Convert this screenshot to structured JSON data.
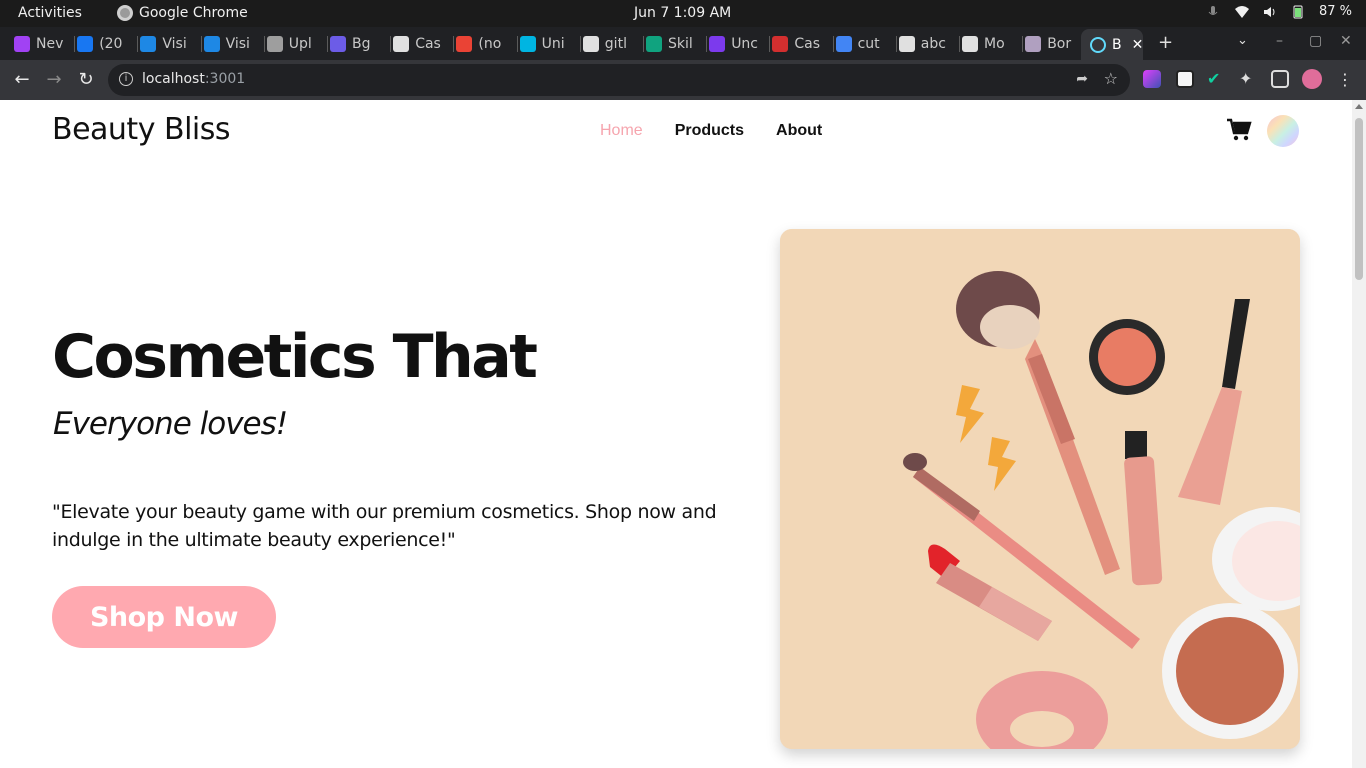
{
  "os": {
    "activities": "Activities",
    "app_name": "Google Chrome",
    "clock": "Jun 7   1:09 AM",
    "battery": "87 %"
  },
  "browser": {
    "tabs": [
      {
        "label": "Nev",
        "color": "#a142f4"
      },
      {
        "label": "(20",
        "color": "#1877f2"
      },
      {
        "label": "Visi",
        "color": "#1e88e5"
      },
      {
        "label": "Visi",
        "color": "#1e88e5"
      },
      {
        "label": "Upl",
        "color": "#9e9e9e"
      },
      {
        "label": "Bg",
        "color": "#6c5ce7"
      },
      {
        "label": "Cas",
        "color": "#e0e0e0"
      },
      {
        "label": "(no",
        "color": "#ea4335"
      },
      {
        "label": "Uni",
        "color": "#00b5e2"
      },
      {
        "label": "gitl",
        "color": "#e0e0e0"
      },
      {
        "label": "Skil",
        "color": "#10a37f"
      },
      {
        "label": "Unc",
        "color": "#7c3aed"
      },
      {
        "label": "Cas",
        "color": "#d32f2f"
      },
      {
        "label": "cut",
        "color": "#4285f4"
      },
      {
        "label": "abc",
        "color": "#e0e0e0"
      },
      {
        "label": "Mo",
        "color": "#e0e0e0"
      },
      {
        "label": "Bor",
        "color": "#b0a0c0"
      }
    ],
    "active_tab": {
      "label": "B",
      "color": "#61dafb"
    },
    "new_tab": "+",
    "url_host": "localhost",
    "url_port": ":3001"
  },
  "site": {
    "brand": "Beauty Bliss",
    "nav": [
      {
        "label": "Home",
        "active": true
      },
      {
        "label": "Products",
        "active": false
      },
      {
        "label": "About",
        "active": false
      }
    ],
    "hero": {
      "title": "Cosmetics That",
      "subtitle": "Everyone loves!",
      "text": "\"Elevate your beauty game with our premium cosmetics. Shop now and indulge in the ultimate beauty experience!\"",
      "cta": "Shop Now"
    }
  },
  "colors": {
    "accent": "#ffa9b0",
    "nav_active": "#f6a5ae",
    "image_bg": "#f2d7b7"
  }
}
